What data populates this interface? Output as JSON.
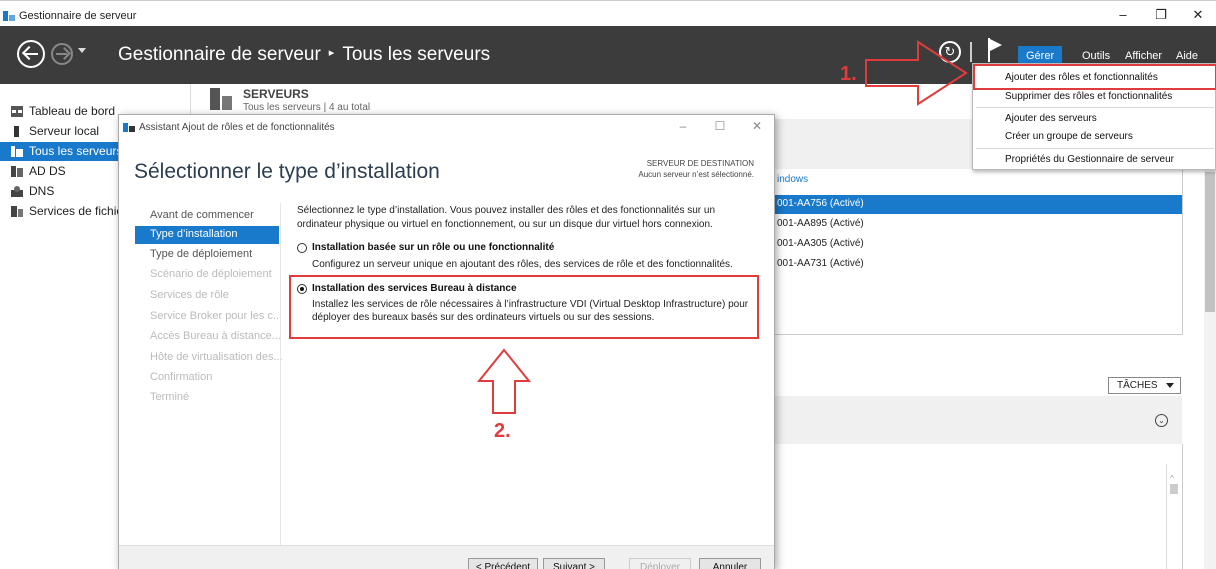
{
  "window": {
    "title": "Gestionnaire de serveur"
  },
  "window_controls": {
    "minimize": "–",
    "restore": "❐",
    "close": "✕"
  },
  "breadcrumb": {
    "root": "Gestionnaire de serveur",
    "separator": "▸",
    "current": "Tous les serveurs"
  },
  "commandbar": {
    "menus": [
      "Gérer",
      "Outils",
      "Afficher",
      "Aide"
    ],
    "active_menu_color": "#1979ca"
  },
  "dropdown": {
    "items": [
      "Ajouter des rôles et fonctionnalités",
      "Supprimer des rôles et fonctionnalités",
      "Ajouter des serveurs",
      "Créer un groupe de serveurs",
      "Propriétés du Gestionnaire de serveur"
    ]
  },
  "sidebar": {
    "items": [
      {
        "label": "Tableau de bord",
        "icon": "dashboard-icon"
      },
      {
        "label": "Serveur local",
        "icon": "server-icon"
      },
      {
        "label": "Tous les serveurs",
        "icon": "servers-icon",
        "selected": true
      },
      {
        "label": "AD DS",
        "icon": "adds-icon"
      },
      {
        "label": "DNS",
        "icon": "dns-icon"
      },
      {
        "label": "Services de fichiers",
        "icon": "files-icon"
      }
    ]
  },
  "servers_tile": {
    "title": "SERVEURS",
    "subtitle": "Tous les serveurs | 4 au total"
  },
  "server_list": {
    "column": "indows",
    "rows": [
      "001-AA756 (Activé)",
      "001-AA895 (Activé)",
      "001-AA305 (Activé)",
      "001-AA731 (Activé)"
    ]
  },
  "tasks_label": "TÂCHES",
  "wizard": {
    "title": "Assistant Ajout de rôles et de fonctionnalités",
    "heading": "Sélectionner le type d’installation",
    "destination_label": "SERVEUR DE DESTINATION",
    "destination_value": "Aucun serveur n’est sélectionné.",
    "steps": [
      "Avant de commencer",
      "Type d’installation",
      "Type de déploiement",
      "Scénario de déploiement",
      "Services de rôle",
      "Service Broker pour les c...",
      "Accès Bureau à distance...",
      "Hôte de virtualisation des...",
      "Confirmation",
      "Terminé"
    ],
    "intro": "Sélectionnez le type d’installation. Vous pouvez installer des rôles et des fonctionnalités sur un ordinateur physique ou virtuel en fonctionnement, ou sur un disque dur virtuel hors connexion.",
    "option1_title": "Installation basée sur un rôle ou une fonctionnalité",
    "option1_desc": "Configurez un serveur unique en ajoutant des rôles, des services de rôle et des fonctionnalités.",
    "option2_title": "Installation des services Bureau à distance",
    "option2_desc": "Installez les services de rôle nécessaires à l’infrastructure VDI (Virtual Desktop Infrastructure) pour déployer des bureaux basés sur des ordinateurs virtuels ou sur des sessions.",
    "selected_option": 2,
    "buttons": {
      "prev": "< Précédent",
      "next": "Suivant >",
      "deploy": "Déployer",
      "cancel": "Annuler"
    }
  },
  "annotations": {
    "step1": "1.",
    "step2": "2.",
    "color": "#e03c3c"
  }
}
